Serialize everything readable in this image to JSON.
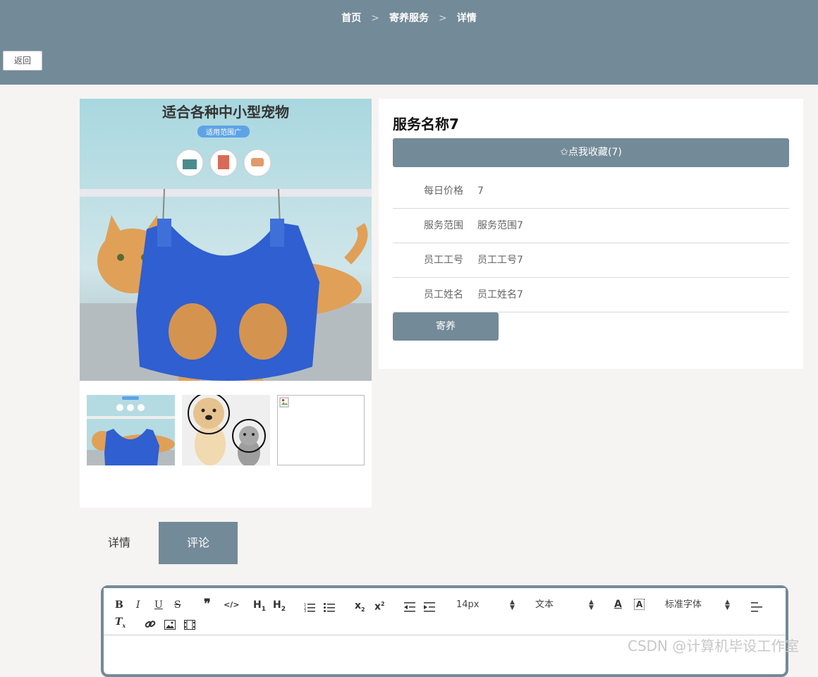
{
  "breadcrumb": {
    "home": "首页",
    "sep1": ">",
    "service": "寄养服务",
    "sep2": ">",
    "current": "详情"
  },
  "back_label": "返回",
  "gallery": {
    "main_image_text": {
      "title": "适合各种中小型宠物",
      "badge": "适用范围广"
    },
    "thumbnails": [
      "cat-in-sling",
      "dog-and-cat-cones",
      "broken-image"
    ]
  },
  "service": {
    "name": "服务名称7",
    "favorite_label": "✩点我收藏(7)",
    "fields": [
      {
        "label": "每日价格",
        "value": "7"
      },
      {
        "label": "服务范围",
        "value": "服务范围7"
      },
      {
        "label": "员工工号",
        "value": "员工工号7"
      },
      {
        "label": "员工姓名",
        "value": "员工姓名7"
      }
    ],
    "board_label": "寄养"
  },
  "tabs": [
    {
      "label": "详情",
      "active": false
    },
    {
      "label": "评论",
      "active": true
    }
  ],
  "editor": {
    "font_size": "14px",
    "paragraph": "文本",
    "font_family": "标准字体",
    "icons": [
      "bold-icon",
      "italic-icon",
      "underline-icon",
      "strikethrough-icon",
      "quote-icon",
      "code-icon",
      "h1-icon",
      "h2-icon",
      "ordered-list-icon",
      "bullet-list-icon",
      "subscript-icon",
      "superscript-icon",
      "outdent-icon",
      "indent-icon",
      "font-color-icon",
      "background-color-icon",
      "align-left-icon",
      "clear-format-icon",
      "link-icon",
      "image-icon",
      "video-icon"
    ]
  },
  "watermark": "CSDN @计算机毕设工作室",
  "colors": {
    "accent": "#738a98",
    "page_bg": "#f5f4f2"
  }
}
